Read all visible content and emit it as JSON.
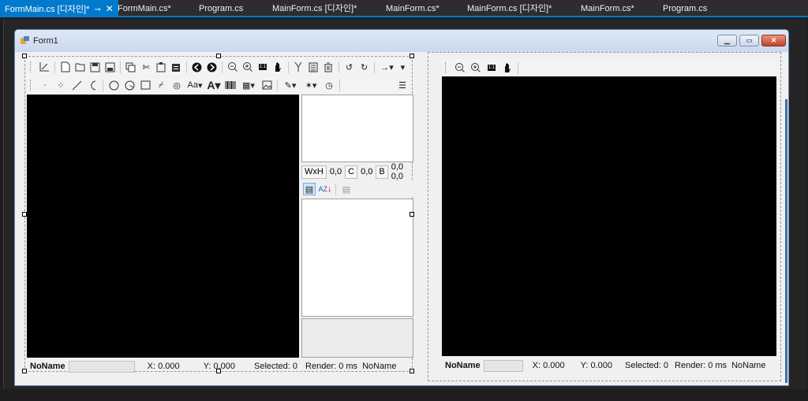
{
  "tabs": [
    {
      "label": "FormMain.cs [디자인]*",
      "active": true
    },
    {
      "label": "FormMain.cs*"
    },
    {
      "label": "Program.cs"
    },
    {
      "label": "MainForm.cs [디자인]*"
    },
    {
      "label": "MainForm.cs*"
    },
    {
      "label": "MainForm.cs [디자인]*"
    },
    {
      "label": "MainForm.cs*"
    },
    {
      "label": "Program.cs"
    }
  ],
  "tab_controls": {
    "pin": "⊸",
    "close": "✕"
  },
  "form": {
    "title": "Form1",
    "min": "▁",
    "max": "▭",
    "close": "✕"
  },
  "toolbar1": [
    "axes-icon",
    "new-icon",
    "open-icon",
    "save-icon",
    "save-as-icon",
    "copy-icon",
    "cut-icon",
    "paste-icon",
    "clipboard-icon",
    "back-icon",
    "forward-icon",
    "zoom-out-icon",
    "zoom-in-icon",
    "actual-size-icon",
    "hand-icon",
    "branch-icon",
    "list-icon",
    "delete-icon",
    "rotate-left-icon",
    "rotate-right-icon",
    "arrow-right-icon",
    "dropdown-icon"
  ],
  "toolbar2": [
    "point-icon",
    "points-icon",
    "line-icon",
    "arc-icon",
    "circle-icon",
    "circle-arc-icon",
    "rect-icon",
    "pattern-icon",
    "target-icon",
    "text-size-icon",
    "font-icon",
    "barcode-icon",
    "image-dropdown-icon",
    "image-icon",
    "pen-icon",
    "magic-icon",
    "timer-icon",
    "layers-icon"
  ],
  "glyphs": {
    "text_size": "Aa",
    "font": "A",
    "actual_size": "1:1"
  },
  "info": {
    "wxh_label": "WxH",
    "wxh_value": "0,0",
    "c_label": "C",
    "c_value": "0,0",
    "b_label": "B",
    "b_value": "0,0 0,0"
  },
  "left_status": {
    "name": "NoName",
    "x": "X: 0.000",
    "y": "Y: 0.000",
    "selected": "Selected: 0",
    "render": "Render: 0 ms",
    "name2": "NoName"
  },
  "right_status": {
    "name": "NoName",
    "x": "X: 0.000",
    "y": "Y: 0.000",
    "selected": "Selected: 0",
    "render": "Render: 0 ms",
    "name2": "NoName"
  },
  "colors": {
    "accent": "#007acc",
    "canvas": "#000000"
  }
}
